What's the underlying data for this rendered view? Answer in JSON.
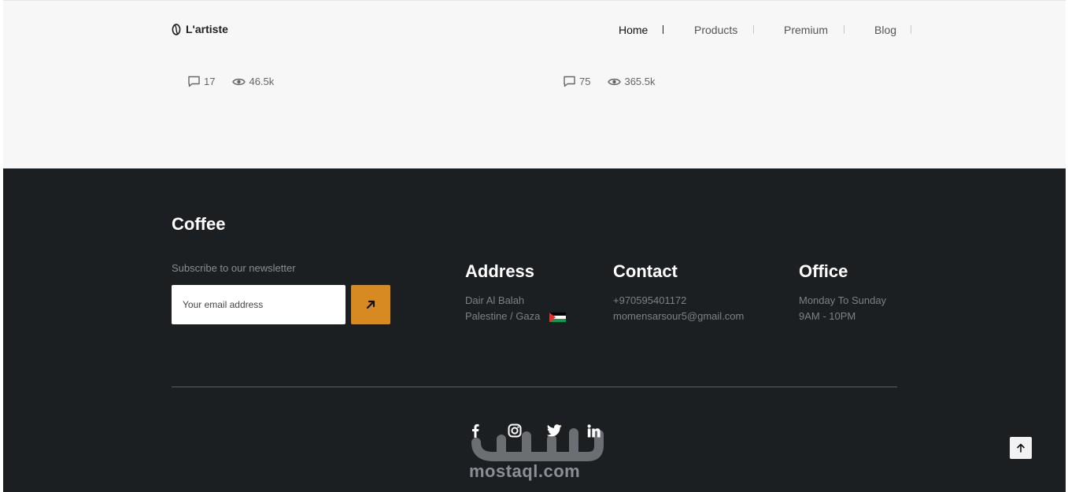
{
  "header": {
    "logo_text": "L'artiste",
    "nav": [
      {
        "label": "Home",
        "active": true
      },
      {
        "label": "Products",
        "active": false
      },
      {
        "label": "Premium",
        "active": false
      },
      {
        "label": "Blog",
        "active": false
      }
    ]
  },
  "posts": [
    {
      "comments": "17",
      "views": "46.5k"
    },
    {
      "comments": "75",
      "views": "365.5k"
    }
  ],
  "footer": {
    "brand": "Coffee",
    "newsletter": {
      "label": "Subscribe to our newsletter",
      "placeholder": "Your email address",
      "submit_icon": "arrow-up-right-icon",
      "accent_color": "#d88a22"
    },
    "address": {
      "title": "Address",
      "line1": "Dair Al Balah",
      "line2": "Palestine / Gaza"
    },
    "contact": {
      "title": "Contact",
      "phone": "+970595401172",
      "email": "momensarsour5@gmail.com"
    },
    "office": {
      "title": "Office",
      "days": "Monday To Sunday",
      "hours": "9AM - 10PM"
    },
    "social": [
      "facebook-icon",
      "instagram-icon",
      "twitter-icon",
      "linkedin-icon"
    ],
    "watermark": "mostaql.com",
    "background_color": "#1c1f22"
  },
  "back_to_top_icon": "arrow-up-icon"
}
